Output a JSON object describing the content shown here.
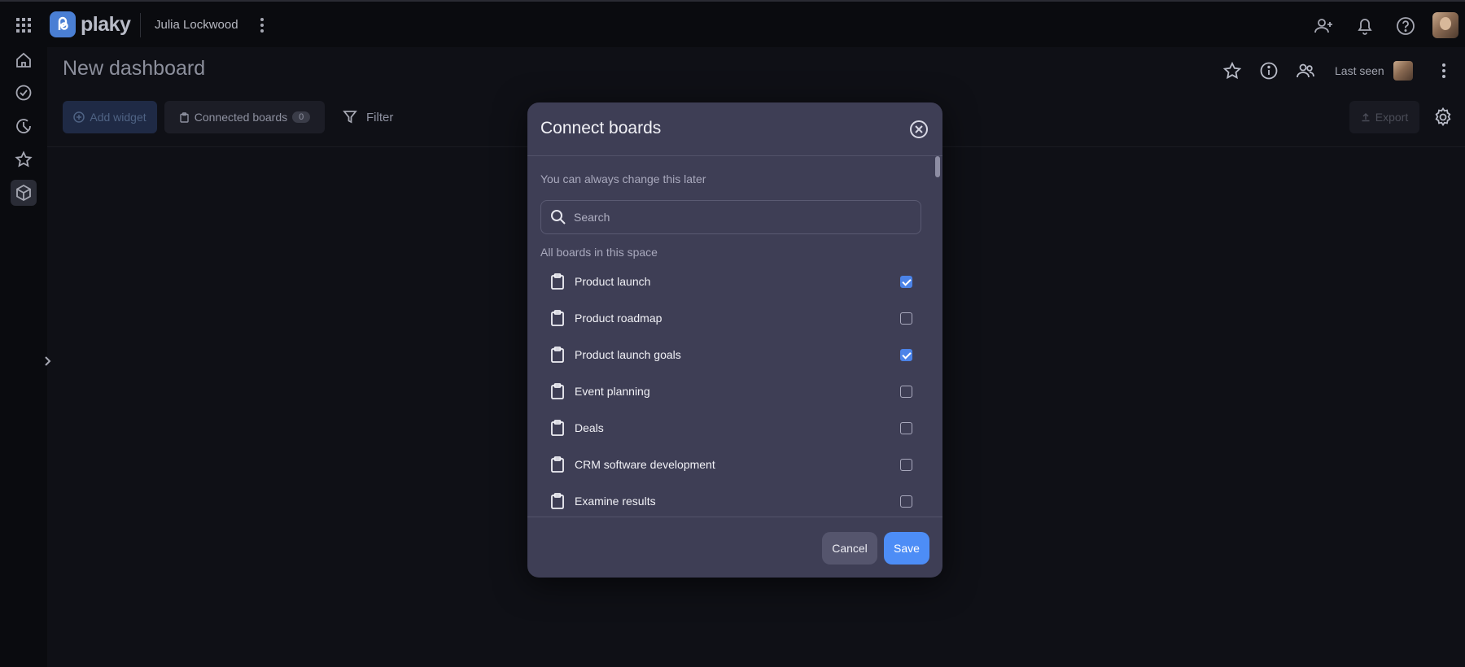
{
  "topbar": {
    "logo_text": "plaky",
    "workspace_name": "Julia Lockwood",
    "icons": [
      "apps-grid-icon",
      "more-vertical-icon",
      "add-user-icon",
      "bell-icon",
      "help-icon"
    ]
  },
  "sidebar": {
    "items": [
      {
        "name": "home-icon"
      },
      {
        "name": "check-circle-icon"
      },
      {
        "name": "recent-icon"
      },
      {
        "name": "star-icon"
      },
      {
        "name": "dashboard-cube-icon",
        "active": true
      }
    ]
  },
  "header": {
    "title": "New dashboard",
    "last_seen_label": "Last seen"
  },
  "toolbar": {
    "add_widget_label": "Add widget",
    "connected_boards_label": "Connected boards",
    "connected_boards_count": "0",
    "filter_label": "Filter",
    "export_label": "Export"
  },
  "modal": {
    "title": "Connect boards",
    "subtitle": "You can always change this later",
    "search_placeholder": "Search",
    "section_label": "All boards in this space",
    "boards": [
      {
        "label": "Product launch",
        "checked": true
      },
      {
        "label": "Product roadmap",
        "checked": false
      },
      {
        "label": "Product launch goals",
        "checked": true
      },
      {
        "label": "Event planning",
        "checked": false
      },
      {
        "label": "Deals",
        "checked": false
      },
      {
        "label": "CRM software development",
        "checked": false
      },
      {
        "label": "Examine results",
        "checked": false
      }
    ],
    "cancel_label": "Cancel",
    "save_label": "Save"
  },
  "colors": {
    "accent": "#4d8df6",
    "modal_bg": "#3e3e55",
    "page_bg": "#0f1016",
    "checkbox_checked": "#4b83e8"
  }
}
